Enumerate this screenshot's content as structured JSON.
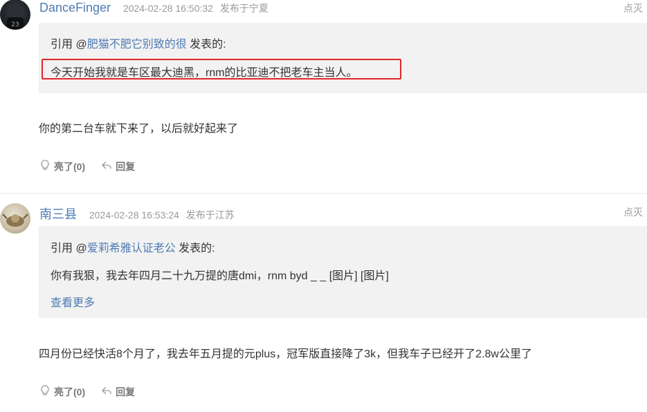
{
  "comments": [
    {
      "username": "DanceFinger",
      "time": "2024-02-28 16:50:32",
      "location": "发布于宁夏",
      "report": "点灭",
      "quote": {
        "prefix": "引用 @",
        "user": "肥猫不肥它别致的很",
        "suffix": " 发表的:",
        "text": "今天开始我就是车区最大迪黑，rnm的比亚迪不把老车主当人。"
      },
      "text": "你的第二台车就下来了，以后就好起来了",
      "like": "亮了(0)",
      "reply": "回复"
    },
    {
      "username": "南三县",
      "time": "2024-02-28 16:53:24",
      "location": "发布于江苏",
      "report": "点灭",
      "quote": {
        "prefix": "引用 @",
        "user": "爱莉希雅认证老公",
        "suffix": " 发表的:",
        "text": "你有我狠，我去年四月二十九万提的唐dmi，rnm byd _ _ [图片] [图片]",
        "more": "查看更多"
      },
      "text": "四月份已经快活8个月了，我去年五月提的元plus，冠军版直接降了3k，但我车子已经开了2.8w公里了",
      "like": "亮了(0)",
      "reply": "回复"
    }
  ],
  "colors": {
    "link": "#4e7bb4",
    "highlight_border": "#e0262b",
    "quote_bg": "#f2f2f2"
  }
}
